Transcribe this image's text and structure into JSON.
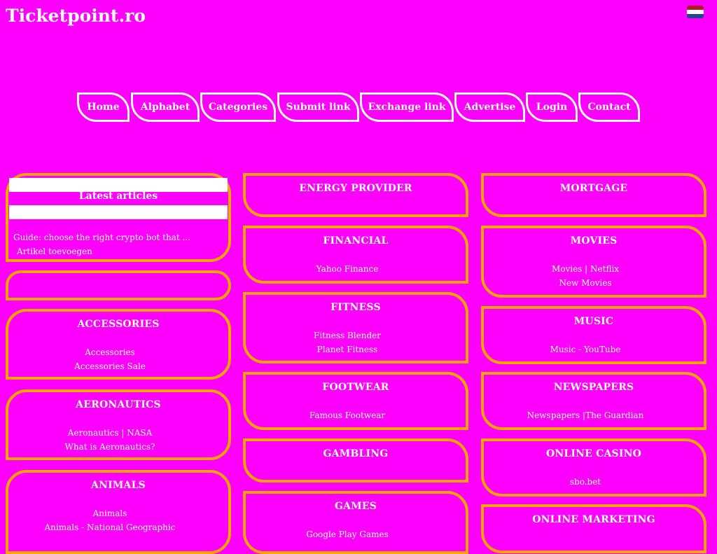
{
  "site": {
    "title": "Ticketpoint.ro"
  },
  "nav": [
    "Home",
    "Alphabet",
    "Categories",
    "Submit link",
    "Exchange link",
    "Advertise",
    "Login",
    "Contact"
  ],
  "latest": {
    "title": "Latest articles",
    "items": [
      "Guide: choose the right crypto bot that ...",
      "Artikel toevoegen"
    ]
  },
  "col1": [
    {
      "title": "ACCESSORIES",
      "links": [
        "Accessories",
        "Accessories Sale"
      ]
    },
    {
      "title": "AERONAUTICS",
      "links": [
        "Aeronautics | NASA",
        "What is Aeronautics?"
      ]
    },
    {
      "title": "ANIMALS",
      "links": [
        "Animals",
        "Animals - National Geographic"
      ]
    }
  ],
  "col2": [
    {
      "title": "ENERGY PROVIDER",
      "links": []
    },
    {
      "title": "FINANCIAL",
      "links": [
        "Yahoo Finance"
      ]
    },
    {
      "title": "FITNESS",
      "links": [
        "Fitness Blender",
        "Planet Fitness"
      ]
    },
    {
      "title": "FOOTWEAR",
      "links": [
        "Famous Footwear"
      ]
    },
    {
      "title": "GAMBLING",
      "links": []
    },
    {
      "title": "GAMES",
      "links": [
        "Google Play Games"
      ]
    }
  ],
  "col3": [
    {
      "title": "MORTGAGE",
      "links": []
    },
    {
      "title": "MOVIES",
      "links": [
        "Movies | Netflix",
        "New Movies"
      ]
    },
    {
      "title": "MUSIC",
      "links": [
        "Music - YouTube"
      ]
    },
    {
      "title": "NEWSPAPERS",
      "links": [
        "Newspapers |The Guardian"
      ]
    },
    {
      "title": "ONLINE CASINO",
      "links": [
        "sbo.bet"
      ]
    },
    {
      "title": "ONLINE MARKETING",
      "links": []
    }
  ]
}
